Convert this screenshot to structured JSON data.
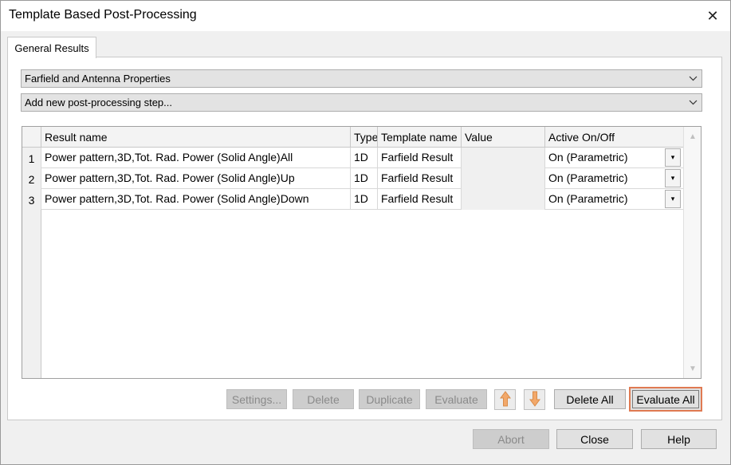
{
  "window": {
    "title": "Template Based Post-Processing",
    "close_glyph": "✕"
  },
  "tabs": [
    {
      "label": "General Results"
    }
  ],
  "combos": {
    "category": {
      "value": "Farfield and Antenna Properties"
    },
    "add_step": {
      "value": "Add new post-processing step..."
    }
  },
  "table": {
    "headers": {
      "result_name": "Result name",
      "type": "Type",
      "template_name": "Template name",
      "value": "Value",
      "active": "Active On/Off"
    },
    "rows": [
      {
        "num": "1",
        "result_name": "Power pattern,3D,Tot. Rad. Power (Solid Angle)All",
        "type": "1D",
        "template_name": "Farfield Result",
        "value": "",
        "active": "On (Parametric)"
      },
      {
        "num": "2",
        "result_name": "Power pattern,3D,Tot. Rad. Power (Solid Angle)Up",
        "type": "1D",
        "template_name": "Farfield Result",
        "value": "",
        "active": "On (Parametric)"
      },
      {
        "num": "3",
        "result_name": "Power pattern,3D,Tot. Rad. Power (Solid Angle)Down",
        "type": "1D",
        "template_name": "Farfield Result",
        "value": "",
        "active": "On (Parametric)"
      }
    ]
  },
  "actions": {
    "settings": "Settings...",
    "delete": "Delete",
    "duplicate": "Duplicate",
    "evaluate": "Evaluate",
    "delete_all": "Delete All",
    "evaluate_all": "Evaluate All"
  },
  "footer": {
    "abort": "Abort",
    "close": "Close",
    "help": "Help"
  },
  "colors": {
    "highlight": "#e07a52",
    "arrow_fill": "#f2a86a"
  },
  "icons": {
    "move_up": "move-up-arrow-icon",
    "move_down": "move-down-arrow-icon",
    "dropdown": "chevron-down-icon"
  }
}
